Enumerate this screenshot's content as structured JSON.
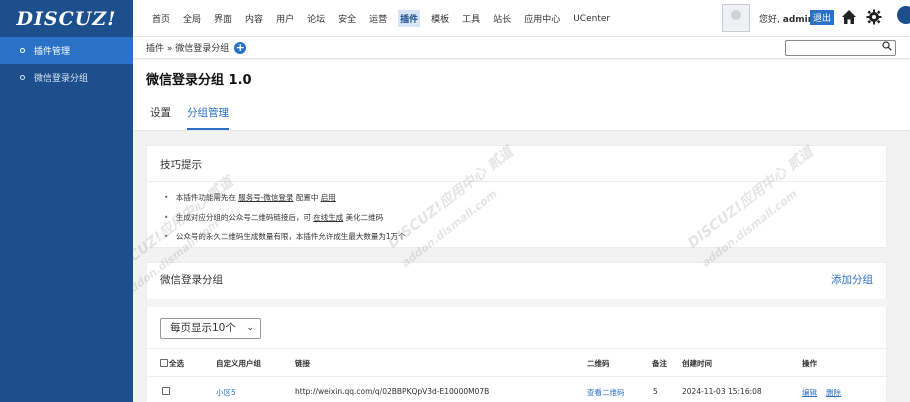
{
  "app": {
    "logo": "DISCUZ!",
    "top_nav": [
      "首页",
      "全局",
      "界面",
      "内容",
      "用户",
      "论坛",
      "安全",
      "运营",
      "插件",
      "模板",
      "工具",
      "站长",
      "应用中心",
      "UCenter"
    ],
    "active_nav_index": 8,
    "greeting_prefix": "您好,",
    "username": "admin",
    "logout_label": "退出",
    "icons": [
      "home-icon",
      "gear-icon",
      "moon-icon"
    ]
  },
  "sidebar": {
    "items": [
      {
        "label": "插件管理",
        "active": true
      },
      {
        "label": "微信登录分组",
        "active": false
      }
    ]
  },
  "breadcrumb": {
    "text": "插件 » 微信登录分组",
    "search_value": ""
  },
  "plugin": {
    "title": "微信登录分组 1.0",
    "tabs": [
      {
        "label": "设置",
        "active": false
      },
      {
        "label": "分组管理",
        "active": true
      }
    ]
  },
  "tips": {
    "title": "技巧提示",
    "items": [
      {
        "before": "本插件功能需先在",
        "link": "服务号-微信登录",
        "middle": "配置中",
        "link2": "启用",
        "after": ""
      },
      {
        "before": "生成对应分组的公众号二维码链接后，可",
        "link": "在线生成",
        "middle": "美化二维码",
        "link2": "",
        "after": ""
      },
      {
        "before": "公众号的永久二维码生成数量有限，本插件允许成生最大数量为1万个",
        "link": "",
        "middle": "",
        "link2": "",
        "after": ""
      }
    ]
  },
  "groups": {
    "title": "微信登录分组",
    "add_label": "添加分组",
    "per_page": "每页显示10个",
    "columns": [
      "全选",
      "自定义用户组",
      "链接",
      "二维码",
      "备注",
      "创建时间",
      "操作"
    ],
    "rows": [
      {
        "group": "小区5",
        "link": "http://weixin.qq.com/q/02BBPKQpV3d-E10000M07B",
        "qrcode": "查看二维码",
        "note": "5",
        "created": "2024-11-03 15:16:08",
        "edit": "编辑",
        "delete": "删除"
      }
    ]
  },
  "watermark": [
    "DISCUZ!应用中心",
    "贰道",
    "addon.dismall.com"
  ]
}
